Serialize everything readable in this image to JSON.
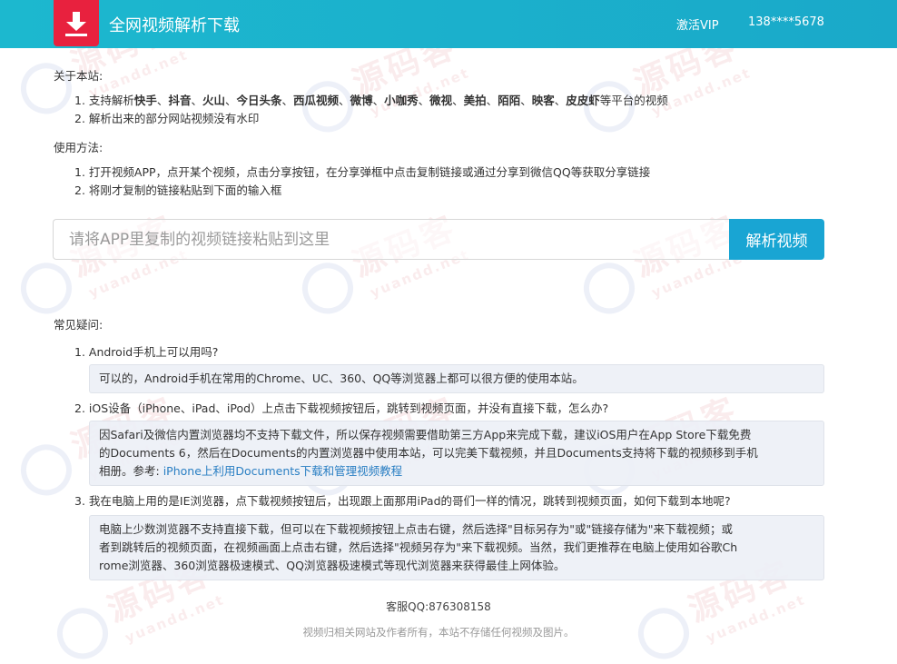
{
  "header": {
    "title": "全网视频解析下载",
    "vip_label": "激活VIP",
    "user_phone": "138****5678",
    "brand_color": "#1cb8cf",
    "logo_color": "#e8213e"
  },
  "about": {
    "title": "关于本站:",
    "item1": {
      "prefix": "1. 支持解析",
      "p1": "快手",
      "s1": "、",
      "p2": "抖音",
      "s2": "、",
      "p3": "火山",
      "s3": "、",
      "p4": "今日头条",
      "s4": "、",
      "p5": "西瓜视频",
      "s5": "、",
      "p6": "微博",
      "s6": "、",
      "p7": "小咖秀",
      "s7": "、",
      "p8": "微视",
      "s8": "、",
      "p9": "美拍",
      "s9": "、",
      "p10": "陌陌",
      "s10": "、",
      "p11": "映客",
      "s11": "、",
      "p12": "皮皮虾",
      "suffix": "等平台的视频"
    },
    "item2": "2. 解析出来的部分网站视频没有水印"
  },
  "usage": {
    "title": "使用方法:",
    "item1": "1. 打开视频APP，点开某个视频，点击分享按钮，在分享弹框中点击复制链接或通过分享到微信QQ等获取分享链接",
    "item2": "2. 将刚才复制的链接粘贴到下面的输入框"
  },
  "search": {
    "placeholder": "请将APP里复制的视频链接粘贴到这里",
    "value": "",
    "button_label": "解析视频",
    "button_color": "#19a5d3"
  },
  "faq": {
    "title": "常见疑问:",
    "q1": "1. Android手机上可以用吗?",
    "a1": "可以的，Android手机在常用的Chrome、UC、360、QQ等浏览器上都可以很方便的使用本站。",
    "q2": "2. iOS设备（iPhone、iPad、iPod）上点击下载视频按钮后，跳转到视频页面，并没有直接下载，怎么办?",
    "a2_line1": "因Safari及微信内置浏览器均不支持下载文件，所以保存视频需要借助第三方App来完成下载，建议iOS用户在App Store下载免费",
    "a2_line2": "的Documents 6，然后在Documents的内置浏览器中使用本站，可以完美下载视频，并且Documents支持将下载的视频移到手机",
    "a2_line3_prefix": "相册。参考: ",
    "a2_link": "iPhone上利用Documents下载和管理视频教程",
    "q3": "3. 我在电脑上用的是IE浏览器，点下载视频按钮后，出现跟上面那用iPad的哥们一样的情况，跳转到视频页面，如何下载到本地呢?",
    "a3_line1": "电脑上少数浏览器不支持直接下载，但可以在下载视频按钮上点击右键，然后选择\"目标另存为\"或\"链接存储为\"来下载视频；或",
    "a3_line2": "者到跳转后的视频页面，在视频画面上点击右键，然后选择\"视频另存为\"来下载视频。当然，我们更推荐在电脑上使用如谷歌Ch",
    "a3_line3": "rome浏览器、360浏览器极速模式、QQ浏览器极速模式等现代浏览器来获得最佳上网体验。"
  },
  "footer": {
    "qq": "客服QQ:876308158",
    "note": "视频归相关网站及作者所有，本站不存储任何视频及图片。"
  },
  "watermark": {
    "text_cn": "源码客",
    "text_en": "yuandd.net"
  }
}
